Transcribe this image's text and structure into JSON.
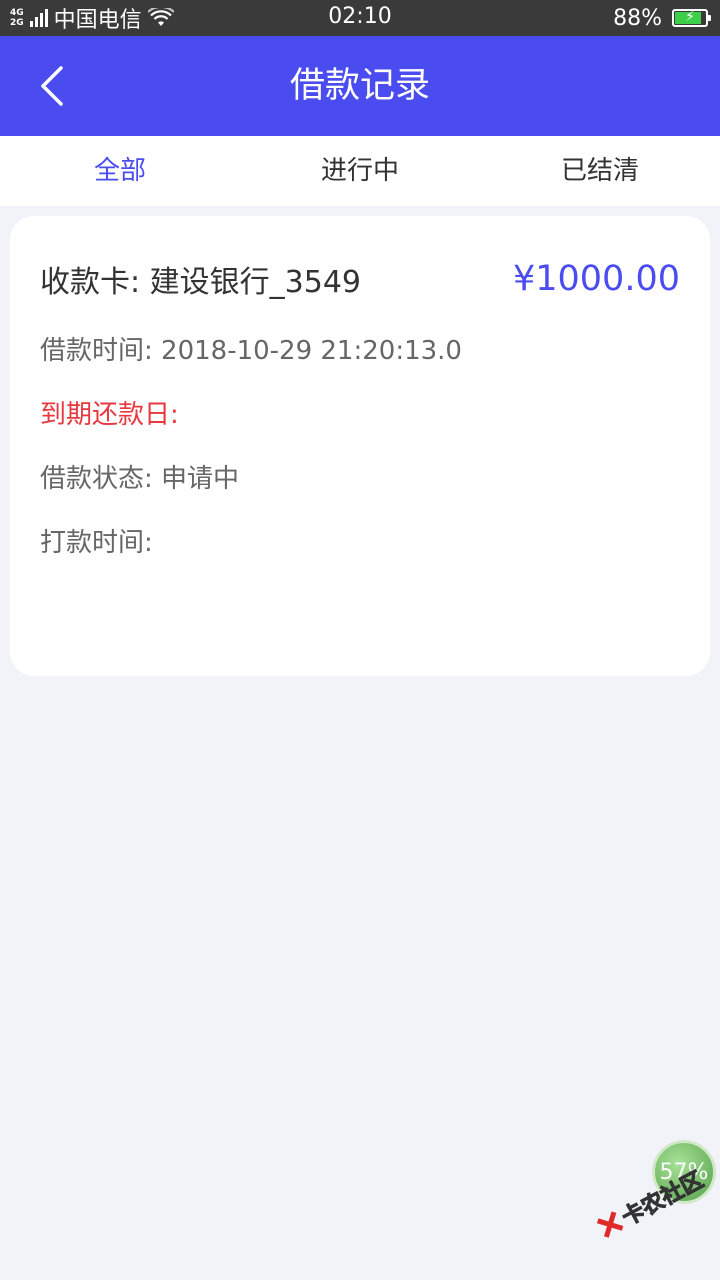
{
  "status_bar": {
    "network_top": "4G",
    "network_bottom": "2G",
    "carrier": "中国电信",
    "time": "02:10",
    "battery_percent": "88%",
    "battery_level": 0.88,
    "battery_color": "#3ecf4a"
  },
  "header": {
    "title": "借款记录",
    "background": "#4a4cf0"
  },
  "tabs": [
    {
      "label": "全部",
      "active": true
    },
    {
      "label": "进行中",
      "active": false
    },
    {
      "label": "已结清",
      "active": false
    }
  ],
  "record": {
    "card_label": "收款卡: 建设银行_3549",
    "amount": "¥1000.00",
    "loan_time": "借款时间: 2018-10-29 21:20:13.0",
    "due_date": "到期还款日:",
    "status": "借款状态: 申请中",
    "payment_time": "打款时间:"
  },
  "colors": {
    "accent": "#4a4cf0",
    "due": "#e8373f",
    "page_background": "#f2f3f8"
  },
  "overlay": {
    "badge_text": "57%",
    "watermark_text": "卡农社区"
  }
}
